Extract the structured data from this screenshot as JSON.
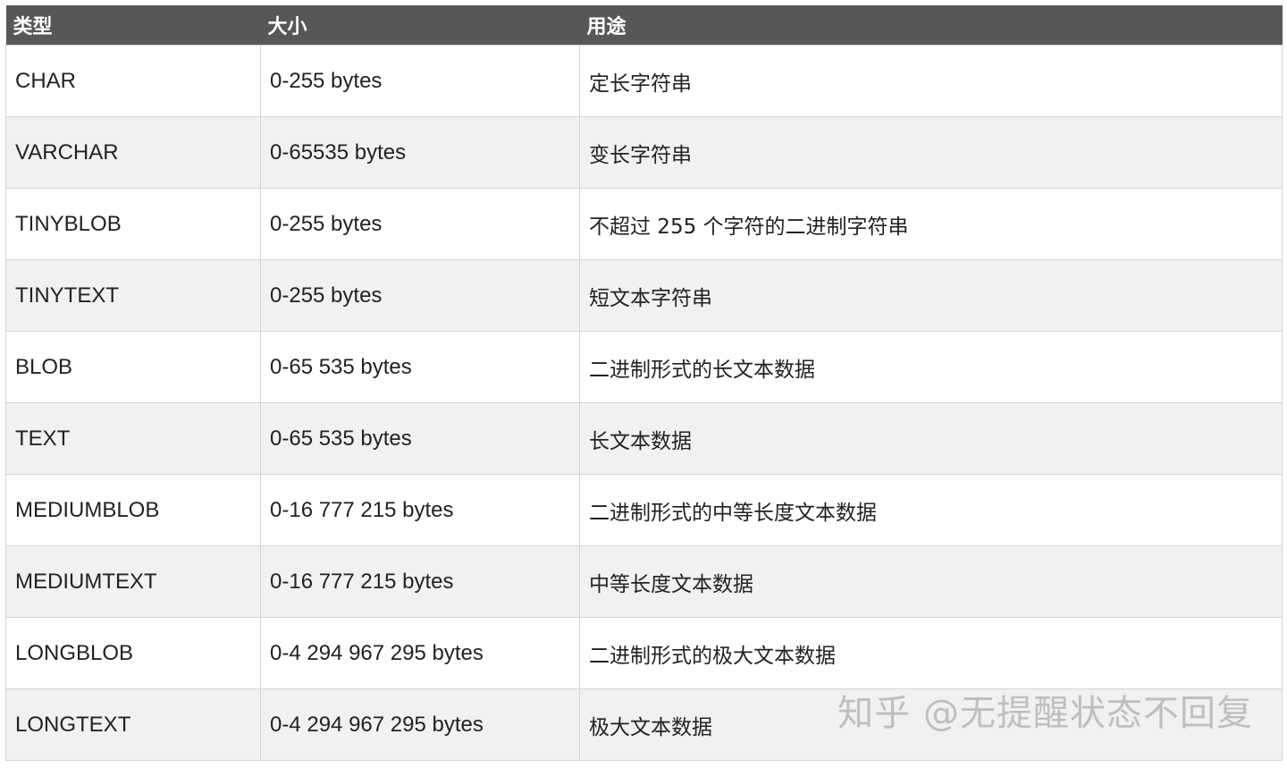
{
  "table": {
    "headers": [
      "类型",
      "大小",
      "用途"
    ],
    "rows": [
      {
        "type": "CHAR",
        "size": "0-255 bytes",
        "usage": "定长字符串"
      },
      {
        "type": "VARCHAR",
        "size": "0-65535 bytes",
        "usage": "变长字符串"
      },
      {
        "type": "TINYBLOB",
        "size": "0-255 bytes",
        "usage": "不超过 255 个字符的二进制字符串"
      },
      {
        "type": "TINYTEXT",
        "size": "0-255 bytes",
        "usage": "短文本字符串"
      },
      {
        "type": "BLOB",
        "size": "0-65 535 bytes",
        "usage": "二进制形式的长文本数据"
      },
      {
        "type": "TEXT",
        "size": "0-65 535 bytes",
        "usage": "长文本数据"
      },
      {
        "type": "MEDIUMBLOB",
        "size": "0-16 777 215 bytes",
        "usage": "二进制形式的中等长度文本数据"
      },
      {
        "type": "MEDIUMTEXT",
        "size": "0-16 777 215 bytes",
        "usage": "中等长度文本数据"
      },
      {
        "type": "LONGBLOB",
        "size": "0-4 294 967 295 bytes",
        "usage": "二进制形式的极大文本数据"
      },
      {
        "type": "LONGTEXT",
        "size": "0-4 294 967 295 bytes",
        "usage": "极大文本数据"
      }
    ]
  },
  "watermark": "知乎 @无提醒状态不回复",
  "colors": {
    "header_bg": "#575757",
    "header_text": "#ffffff",
    "row_alt_bg": "#f2f1ef",
    "border": "#d4d4d4"
  }
}
